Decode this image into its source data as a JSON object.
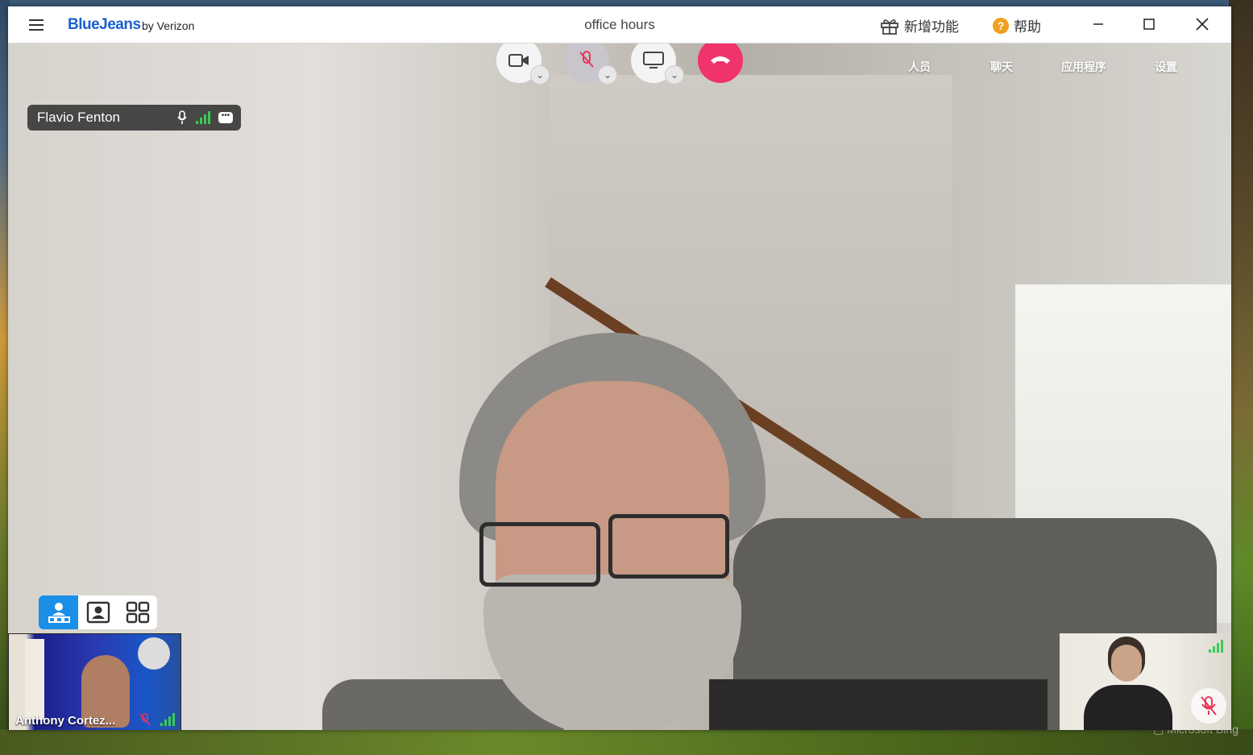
{
  "window": {
    "brand": "BlueJeans",
    "brand_by": "by Verizon",
    "meeting_title": "office hours",
    "whats_new": "新增功能",
    "help": "帮助",
    "help_glyph": "?"
  },
  "right_toolbar": [
    {
      "label": "人员"
    },
    {
      "label": "聊天"
    },
    {
      "label": "应用程序"
    },
    {
      "label": "设置"
    }
  ],
  "main_speaker": {
    "name": "Flavio Fenton"
  },
  "thumbnails": {
    "left_name": "Anthony Cortez..."
  },
  "colors": {
    "brand_blue": "#1a5fd0",
    "end_call": "#f0336a",
    "signal_green": "#3ac95a",
    "layout_active": "#1a8fe8",
    "mute_red": "#e8365a"
  },
  "icons": [
    "hamburger-icon",
    "gift-icon",
    "help-icon",
    "minimize-icon",
    "maximize-icon",
    "close-icon",
    "camera-icon",
    "mic-muted-icon",
    "screen-share-icon",
    "end-call-icon",
    "people-icon",
    "chat-icon",
    "apps-icon",
    "settings-icon",
    "mic-icon",
    "signal-icon",
    "chat-bubble-icon",
    "speaker-layout-icon",
    "people-layout-icon",
    "gallery-layout-icon"
  ]
}
